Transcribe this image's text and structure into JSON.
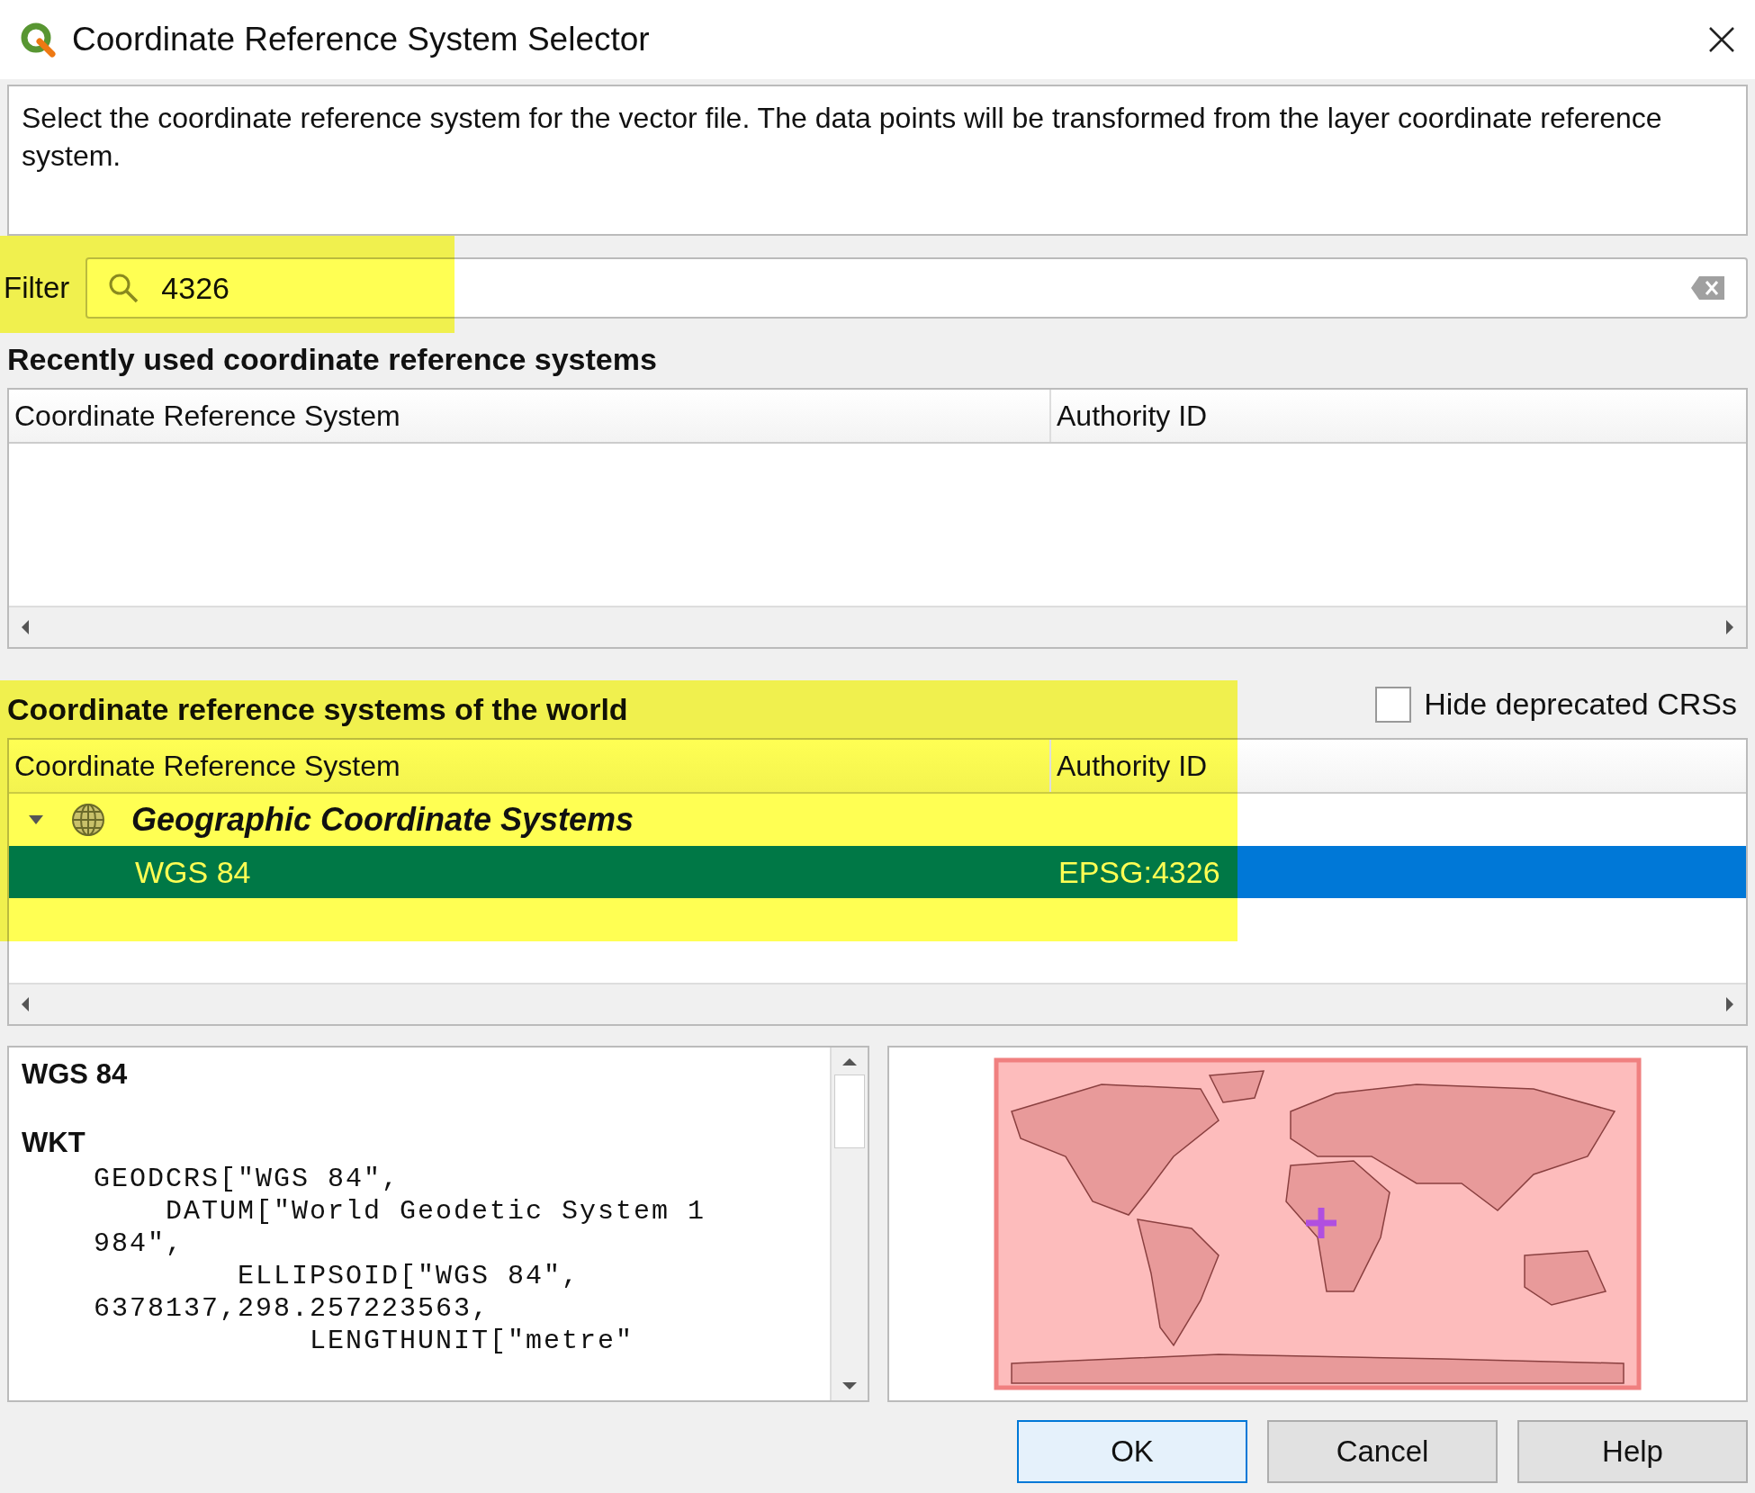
{
  "window": {
    "title": "Coordinate Reference System Selector"
  },
  "description": "Select the coordinate reference system for the vector file. The data points will be transformed from the layer coordinate reference system.",
  "filter": {
    "label": "Filter",
    "value": "4326"
  },
  "recent": {
    "heading": "Recently used coordinate reference systems",
    "columns": [
      "Coordinate Reference System",
      "Authority ID"
    ]
  },
  "world": {
    "heading": "Coordinate reference systems of the world",
    "hide_deprecated": {
      "label": "Hide deprecated CRSs",
      "checked": false
    },
    "columns": [
      "Coordinate Reference System",
      "Authority ID"
    ],
    "tree": [
      {
        "label": "Geographic Coordinate Systems",
        "expanded": true,
        "children": [
          {
            "label": "WGS 84",
            "authority_id": "EPSG:4326",
            "selected": true
          }
        ]
      }
    ]
  },
  "details": {
    "name": "WGS 84",
    "section": "WKT",
    "wkt_lines": [
      "    GEODCRS[\"WGS 84\",",
      "        DATUM[\"World Geodetic System 1",
      "    984\",",
      "            ELLIPSOID[\"WGS 84\",",
      "    6378137,298.257223563,",
      "                LENGTHUNIT[\"metre\""
    ]
  },
  "buttons": [
    {
      "label": "OK",
      "default": true
    },
    {
      "label": "Cancel",
      "default": false
    },
    {
      "label": "Help",
      "default": false
    }
  ]
}
